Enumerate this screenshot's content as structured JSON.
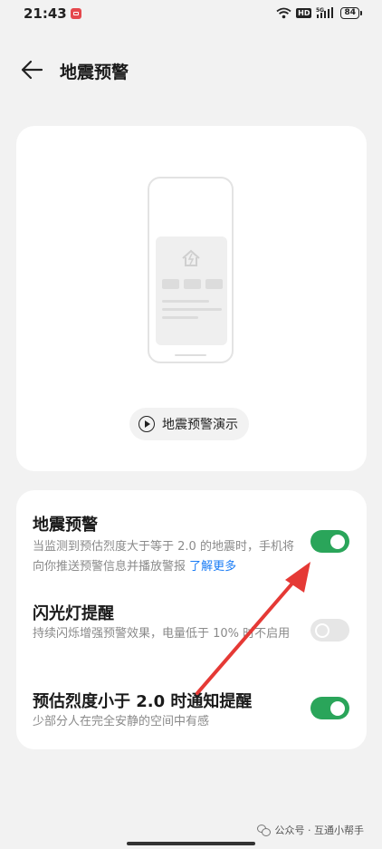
{
  "status_bar": {
    "time": "21:43",
    "hd_label": "HD",
    "network_label": "5G",
    "battery": "84",
    "notification_icon": "app-notification-icon"
  },
  "header": {
    "title": "地震预警",
    "back_icon": "back-arrow-icon"
  },
  "demo": {
    "button_label": "地震预警演示",
    "illustration": "phone-mockup-illustration"
  },
  "settings": [
    {
      "title": "地震预警",
      "description": "当监测到预估烈度大于等于 2.0 的地震时，手机将向你推送预警信息并播放警报",
      "link": "了解更多",
      "enabled": true
    },
    {
      "title": "闪光灯提醒",
      "description": "持续闪烁增强预警效果，电量低于 10% 时不启用",
      "enabled": false
    },
    {
      "title": "预估烈度小于 2.0 时通知提醒",
      "description": "少部分人在完全安静的空间中有感",
      "enabled": true
    }
  ],
  "colors": {
    "toggle_on": "#2aa55a",
    "link": "#1a7cf5",
    "annotation_arrow": "#e53935"
  },
  "watermark": {
    "text": "公众号 · 互通小帮手"
  }
}
